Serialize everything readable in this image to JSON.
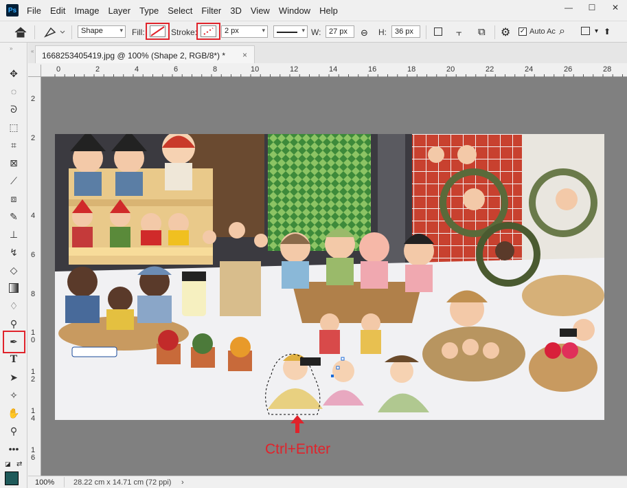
{
  "app": {
    "logo": "Ps"
  },
  "menu": [
    "File",
    "Edit",
    "Image",
    "Layer",
    "Type",
    "Select",
    "Filter",
    "3D",
    "View",
    "Window",
    "Help"
  ],
  "window_controls": {
    "minimize": "—",
    "restore": "☐",
    "close": "✕"
  },
  "options": {
    "shape_mode": "Shape",
    "fill_label": "Fill:",
    "stroke_label": "Stroke:",
    "stroke_width": "2 px",
    "w_label": "W:",
    "w_value": "27 px",
    "h_label": "H:",
    "h_value": "36 px",
    "auto_label": "Auto Ac"
  },
  "document": {
    "tab_title": "1668253405419.jpg @ 100% (Shape 2, RGB/8*) *",
    "tab_close": "×"
  },
  "rulers": {
    "h": [
      "0",
      "2",
      "4",
      "6",
      "8",
      "10",
      "12",
      "14",
      "16",
      "18",
      "20",
      "22",
      "24",
      "26",
      "28"
    ],
    "v": [
      "2",
      "2",
      "4",
      "6",
      "8",
      "10",
      "12",
      "14",
      "16"
    ]
  },
  "annotation": {
    "text": "Ctrl+Enter",
    "color": "#e0232b"
  },
  "status": {
    "zoom": "100%",
    "info": "28.22 cm x 14.71 cm (72 ppi)"
  },
  "colors": {
    "accent_red": "#e0232b",
    "foreground_swatch": "#1f5a5a"
  }
}
